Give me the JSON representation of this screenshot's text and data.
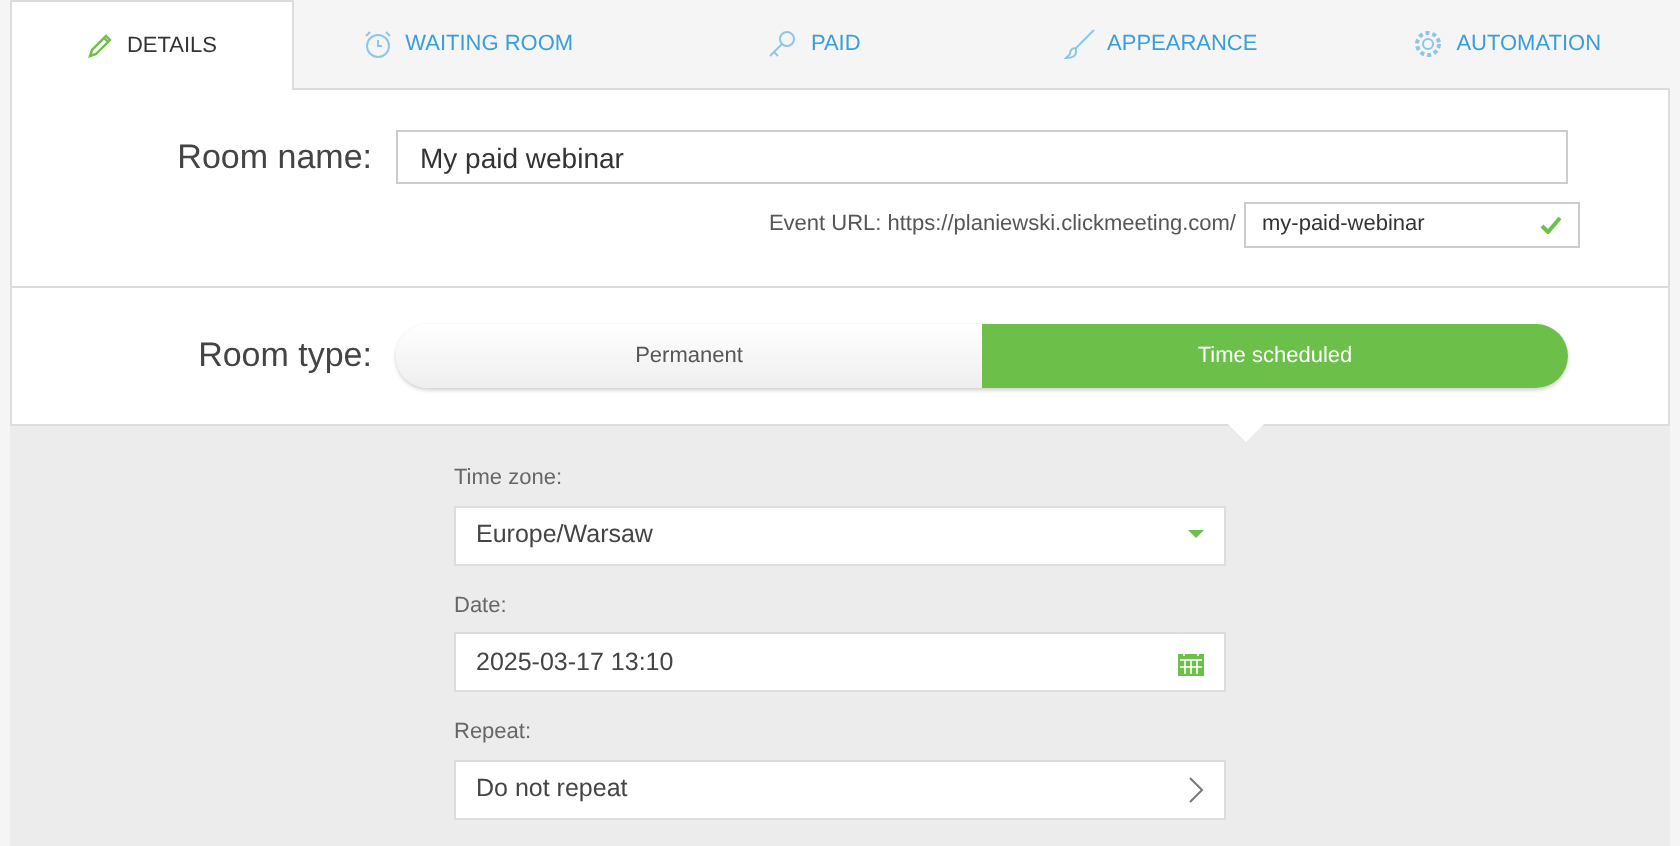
{
  "tabs": [
    {
      "label": "DETAILS",
      "kind": "pencil",
      "selected": true
    },
    {
      "label": "WAITING ROOM",
      "kind": "alarm",
      "selected": false
    },
    {
      "label": "PAID",
      "kind": "key",
      "selected": false
    },
    {
      "label": "APPEARANCE",
      "kind": "brush",
      "selected": false
    },
    {
      "label": "AUTOMATION",
      "kind": "gear",
      "selected": false
    }
  ],
  "room_name": {
    "label": "Room name:",
    "value": "My paid webinar"
  },
  "event_url": {
    "label": "Event URL: https://planiewski.clickmeeting.com/",
    "value": "my-paid-webinar",
    "valid": true
  },
  "room_type": {
    "label": "Room type:",
    "options": [
      {
        "label": "Permanent",
        "selected": false
      },
      {
        "label": "Time scheduled",
        "selected": true
      }
    ]
  },
  "schedule": [
    {
      "kind": "select",
      "label": "Time zone:",
      "value": "Europe/Warsaw"
    },
    {
      "kind": "date",
      "label": "Date:",
      "value": "2025-03-17 13:10"
    },
    {
      "kind": "link",
      "label": "Repeat:",
      "value": "Do not repeat"
    }
  ]
}
